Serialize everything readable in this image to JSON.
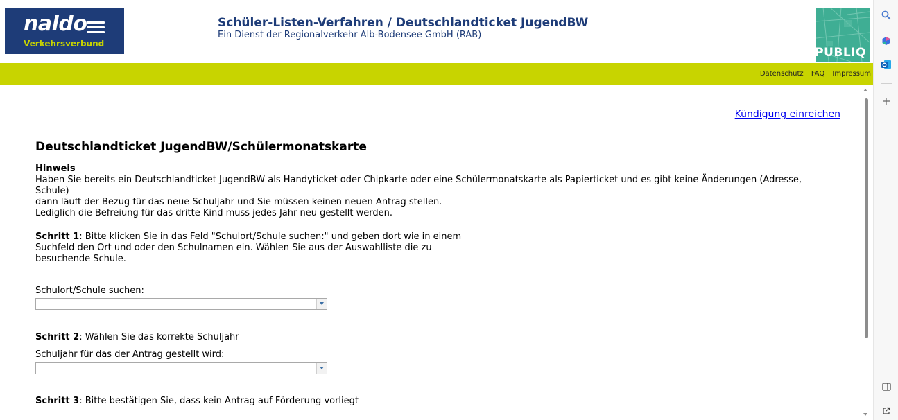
{
  "header": {
    "logo": {
      "brand": "naldo",
      "subtitle": "Verkehrsverbund"
    },
    "title": "Schüler-Listen-Verfahren / Deutschlandticket JugendBW",
    "subtitle": "Ein Dienst der Regionalverkehr Alb-Bodensee GmbH (RAB)",
    "partner_logo": "PUBLIQ"
  },
  "nav": {
    "links": [
      "Datenschutz",
      "FAQ",
      "Impressum"
    ]
  },
  "content": {
    "cancel_link": "Kündigung einreichen",
    "heading": "Deutschlandticket JugendBW/Schülermonatskarte",
    "hinweis_title": "Hinweis",
    "hinweis_lines": [
      "Haben Sie bereits ein Deutschlandticket JugendBW als Handyticket oder Chipkarte oder eine Schülermonatskarte als Papierticket und es gibt keine Änderungen (Adresse,",
      "Schule)",
      "dann läuft der Bezug für das neue Schuljahr und Sie müssen keinen neuen Antrag stellen.",
      "Lediglich die Befreiung für das dritte Kind muss jedes Jahr neu gestellt werden."
    ],
    "step1": {
      "label": "Schritt 1",
      "lines": [
        ": Bitte klicken Sie in das Feld \"Schulort/Schule suchen:\" und geben dort wie in einem",
        "Suchfeld den Ort und oder den Schulnamen ein. Wählen Sie aus der Auswahlliste die zu",
        "besuchende Schule."
      ]
    },
    "school_search": {
      "label": "Schulort/Schule suchen:",
      "value": ""
    },
    "step2": {
      "label": "Schritt 2",
      "text": ": Wählen Sie das korrekte Schuljahr"
    },
    "school_year": {
      "label": "Schuljahr für das der Antrag gestellt wird:",
      "value": ""
    },
    "step3": {
      "label": "Schritt 3",
      "text": ": Bitte bestätigen Sie, dass kein Antrag auf Förderung vorliegt"
    }
  },
  "sidepanel": {
    "icons": [
      "search-icon",
      "copilot-icon",
      "outlook-icon",
      "add-icon",
      "sidebar-toggle-icon",
      "open-external-icon"
    ]
  },
  "colors": {
    "brand_blue": "#1e3c78",
    "nav_green": "#c8d400",
    "publiq_teal": "#3fae94",
    "link_blue": "#0000ee"
  }
}
